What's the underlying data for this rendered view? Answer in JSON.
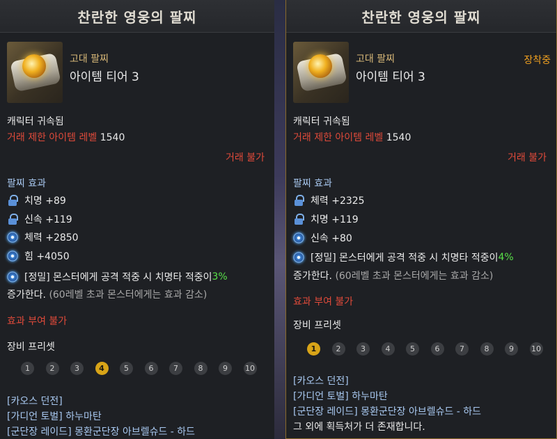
{
  "left": {
    "header": "찬란한 영웅의 팔찌",
    "grade": "고대 팔찌",
    "tier": "아이템 티어 3",
    "bound": "캐릭터 귀속됨",
    "level_label": "거래 제한 아이템 레벨",
    "level_value": "1540",
    "trade": "거래 불가",
    "effect_title": "팔찌 효과",
    "stats": [
      {
        "icon": "lock-icon",
        "text": "치명 +89"
      },
      {
        "icon": "lock-icon",
        "text": "신속 +119"
      },
      {
        "icon": "swirl-icon",
        "text": "체력 +2850"
      },
      {
        "icon": "swirl-icon",
        "text": "힘 +4050"
      }
    ],
    "special_prefix": "[정밀] 몬스터에게 공격 적중 시 치명타 적중이 ",
    "special_value": "3%",
    "special_line2": "증가한다.",
    "special_note": "(60레벨 초과 몬스터에게는 효과 감소)",
    "no_grant": "효과 부여 불가",
    "preset_title": "장비 프리셋",
    "presets": [
      "1",
      "2",
      "3",
      "4",
      "5",
      "6",
      "7",
      "8",
      "9",
      "10"
    ],
    "preset_active": 4,
    "sources": [
      "[카오스 던전]",
      "[가디언 토벌] 하누마탄",
      "[군단장 레이드] 몽환군단장 아브렐슈드 - 하드"
    ]
  },
  "right": {
    "header": "찬란한 영웅의 팔찌",
    "grade": "고대 팔찌",
    "tier": "아이템 티어 3",
    "equipped": "장착중",
    "bound": "캐릭터 귀속됨",
    "level_label": "거래 제한 아이템 레벨",
    "level_value": "1540",
    "trade": "거래 불가",
    "effect_title": "팔찌 효과",
    "stats": [
      {
        "icon": "lock-icon",
        "text": "체력 +2325"
      },
      {
        "icon": "lock-icon",
        "text": "치명 +119"
      },
      {
        "icon": "swirl-icon",
        "text": "신속 +80"
      }
    ],
    "special_prefix": "[정밀] 몬스터에게 공격 적중 시 치명타 적중이 ",
    "special_value": "4%",
    "special_line2": "증가한다.",
    "special_note": "(60레벨 초과 몬스터에게는 효과 감소)",
    "no_grant": "효과 부여 불가",
    "preset_title": "장비 프리셋",
    "presets": [
      "1",
      "2",
      "3",
      "4",
      "5",
      "6",
      "7",
      "8",
      "9",
      "10"
    ],
    "preset_active": 1,
    "sources": [
      "[카오스 던전]",
      "[가디언 토벌] 하누마탄",
      "[군단장 레이드] 몽환군단장 아브렐슈드 - 하드",
      "그 외에 획득처가 더 존재합니다."
    ]
  }
}
